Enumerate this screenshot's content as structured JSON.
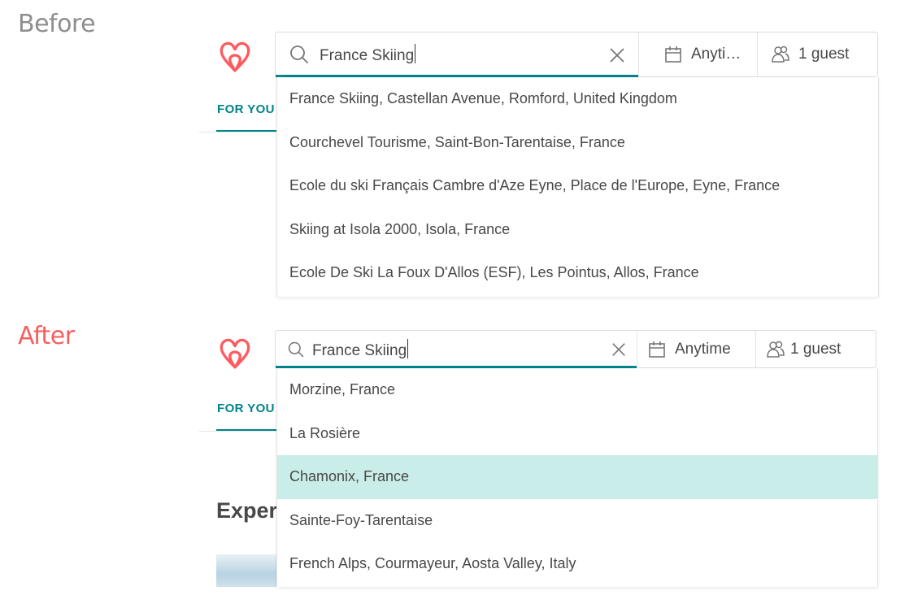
{
  "captions": {
    "before": "Before",
    "after": "After"
  },
  "colors": {
    "accent": "#008489",
    "brand": "#ff5a5f",
    "highlight": "#c9ede8",
    "before_caption": "#8e8e8e",
    "after_caption": "#f5605f"
  },
  "before": {
    "logo": "airbnb-logo",
    "tab": "FOR YOU",
    "search": {
      "value": "France Skiing",
      "icon": "search-icon",
      "clear_icon": "close-icon"
    },
    "dates": {
      "label": "Anyti…",
      "icon": "calendar-icon"
    },
    "guests": {
      "label": "1 guest",
      "icon": "guests-icon"
    },
    "suggestions": [
      {
        "label": "France Skiing, Castellan Avenue, Romford, United Kingdom"
      },
      {
        "label": "Courchevel Tourisme, Saint-Bon-Tarentaise, France"
      },
      {
        "label": "Ecole du ski Français Cambre d'Aze Eyne, Place de l'Europe, Eyne, France"
      },
      {
        "label": "Skiing at Isola 2000, Isola, France"
      },
      {
        "label": "Ecole De Ski La Foux D'Allos (ESF), Les Pointus, Allos, France"
      }
    ]
  },
  "after": {
    "logo": "airbnb-logo",
    "tab": "FOR YOU",
    "section_title": "Exper",
    "search": {
      "value": "France Skiing",
      "icon": "search-icon",
      "clear_icon": "close-icon"
    },
    "dates": {
      "label": "Anytime",
      "icon": "calendar-icon"
    },
    "guests": {
      "label": "1 guest",
      "icon": "guests-icon"
    },
    "suggestions": [
      {
        "label": "Morzine, France"
      },
      {
        "label": "La Rosière"
      },
      {
        "label": "Chamonix, France",
        "highlighted": true
      },
      {
        "label": "Sainte-Foy-Tarentaise"
      },
      {
        "label": "French Alps, Courmayeur, Aosta Valley, Italy"
      }
    ]
  }
}
